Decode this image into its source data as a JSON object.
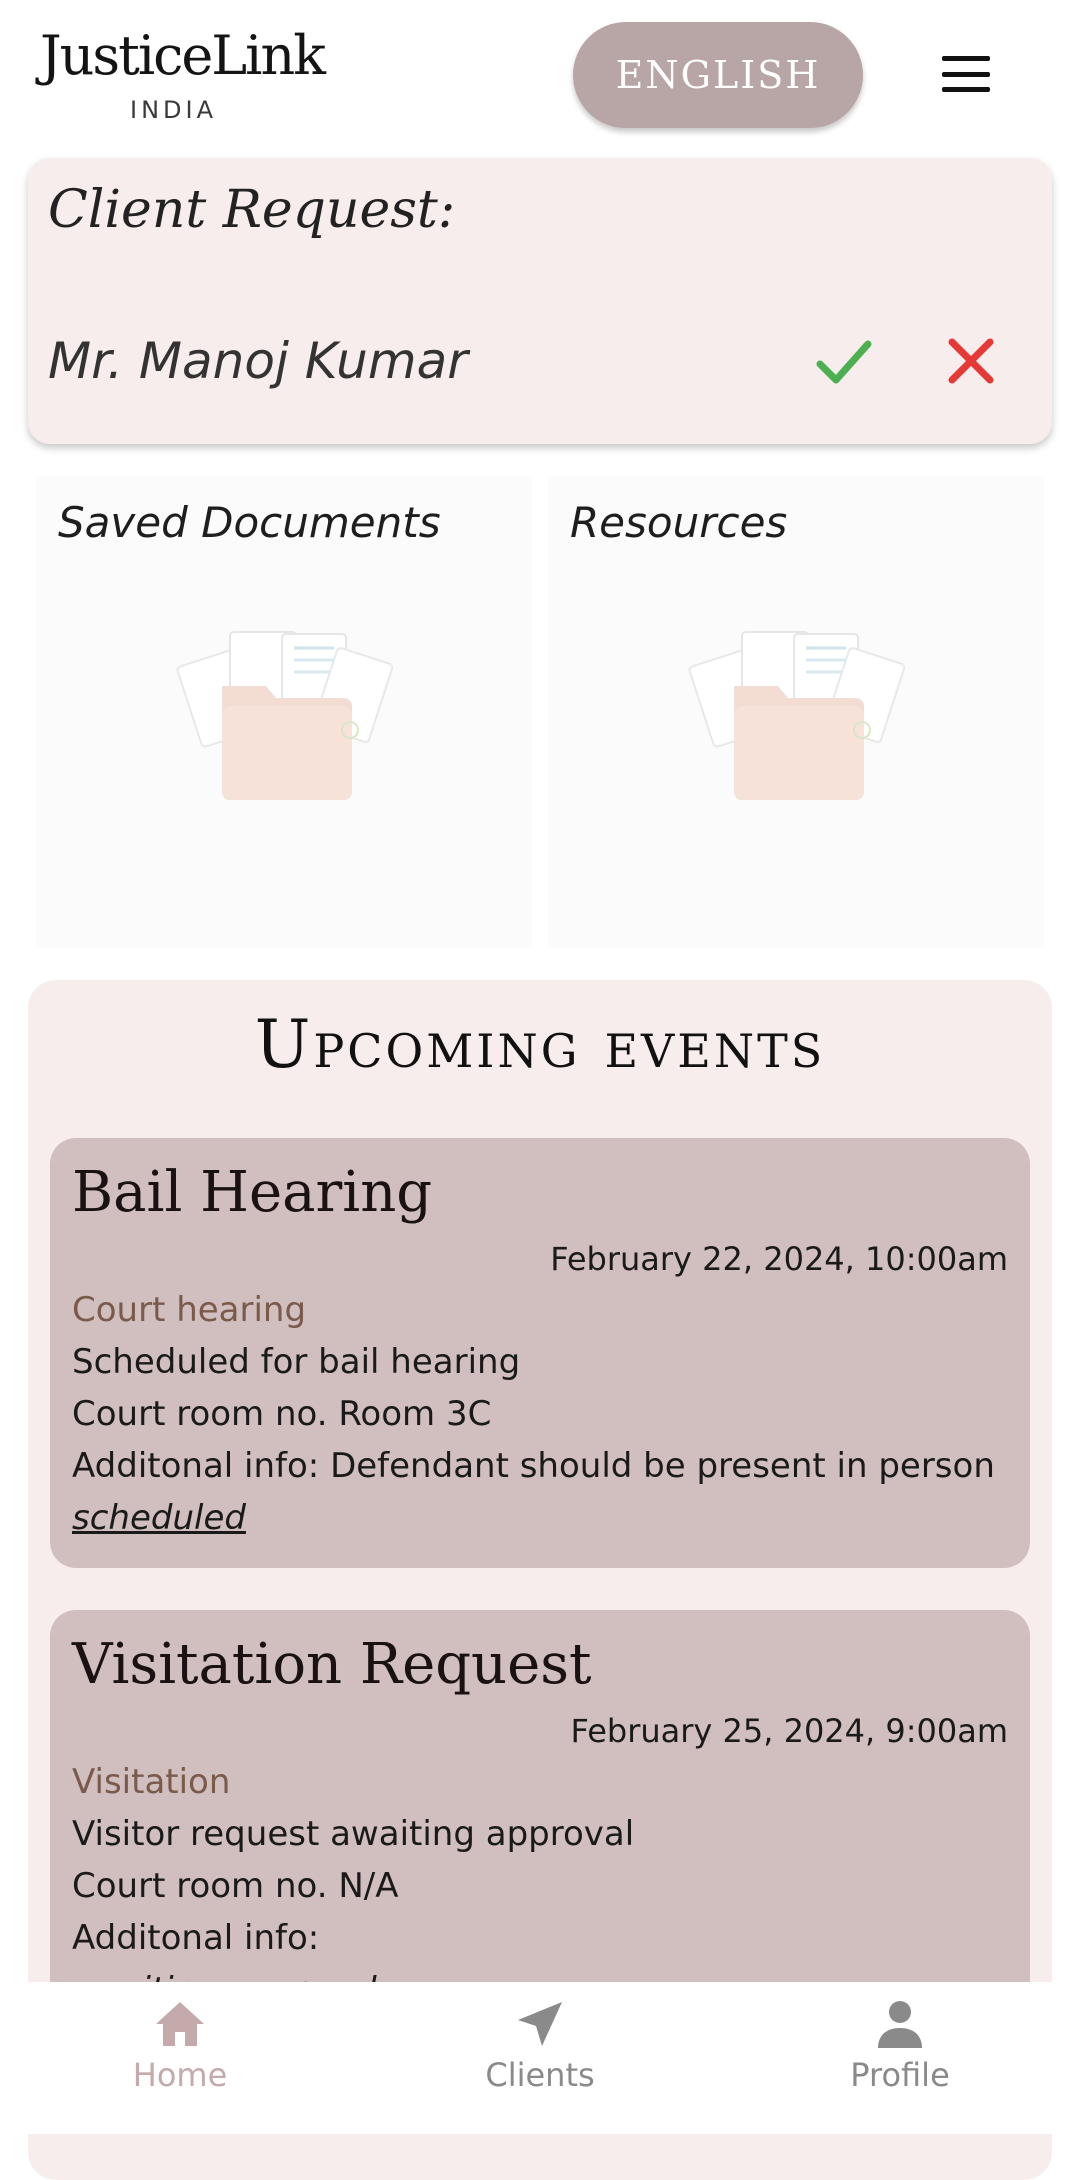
{
  "header": {
    "logo_main": "JusticeLink",
    "logo_sub": "INDIA",
    "language_button": "ENGLISH"
  },
  "client_request": {
    "title": "Client Request:",
    "name": "Mr. Manoj Kumar"
  },
  "panels": {
    "saved_documents": "Saved Documents",
    "resources": "Resources"
  },
  "events": {
    "title": "Upcoming events",
    "items": [
      {
        "title": "Bail Hearing",
        "date": "February 22, 2024, 10:00am",
        "type": "Court hearing",
        "description": "Scheduled for bail hearing",
        "court_room": "Court room no. Room 3C",
        "additional": "Additonal info: Defendant should be present in person",
        "status": "scheduled"
      },
      {
        "title": "Visitation Request",
        "date": "February 25, 2024, 9:00am",
        "type": "Visitation",
        "description": "Visitor request awaiting approval",
        "court_room": "Court room no. N/A",
        "additional": "Additonal info:",
        "status": "awaiting approval"
      }
    ]
  },
  "bottom_nav": {
    "home": "Home",
    "clients": "Clients",
    "profile": "Profile"
  },
  "colors": {
    "accent": "#b8a5a5",
    "card_bg": "#f8eded",
    "event_bg": "#d1bfc0",
    "accept": "#4caf50",
    "reject": "#e53935",
    "nav_active": "#c4aaaa",
    "nav_inactive": "#8a8a8a"
  }
}
